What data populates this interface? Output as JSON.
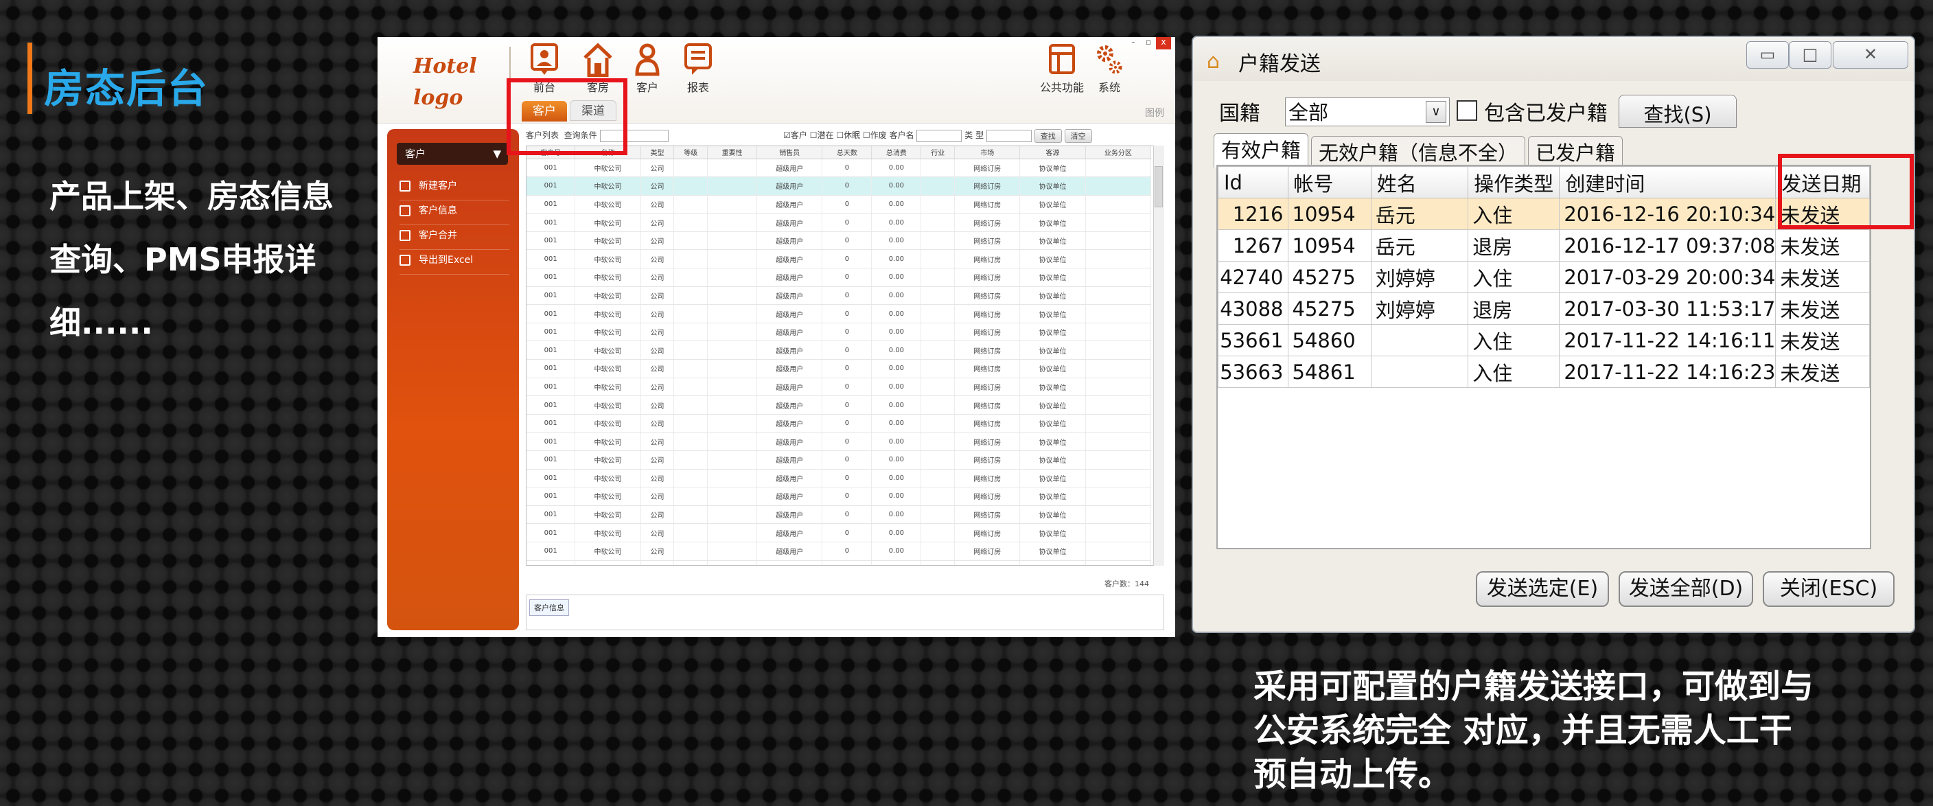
{
  "page": {
    "title": "房态后台",
    "left_desc": [
      "产品上架、房态信息",
      "查询、PMS申报详",
      "细......"
    ],
    "right_desc": [
      "采用可配置的户籍发送接口，可做到与",
      "公安系统完全 对应，并且无需人工干",
      "预自动上传。"
    ]
  },
  "hotel_app": {
    "logo_line1": "Hotel",
    "logo_line2": "logo",
    "nav": [
      {
        "label": "前台",
        "icon": "badge-icon"
      },
      {
        "label": "客房",
        "icon": "house-icon"
      },
      {
        "label": "客户",
        "icon": "person-icon"
      },
      {
        "label": "报表",
        "icon": "report-icon"
      }
    ],
    "nav_right": [
      {
        "label": "公共功能",
        "icon": "panel-icon"
      },
      {
        "label": "系统",
        "icon": "gears-icon"
      }
    ],
    "window_buttons": [
      "-",
      "▫",
      "x"
    ],
    "tabs": [
      "客户",
      "渠道"
    ],
    "legend": "图例",
    "sidebar": {
      "select": "客户",
      "items": [
        "新建客户",
        "客户信息",
        "客户合并",
        "导出到Excel"
      ]
    },
    "filter": {
      "list_label": "客户列表",
      "condition_label": "查询条件",
      "checks": [
        "客户",
        "潜在",
        "休眠",
        "作废"
      ],
      "name_label": "客户名",
      "type_label": "类 型",
      "search_btn": "查找",
      "clear_btn": "清空"
    },
    "columns": [
      "客户号",
      "名称",
      "类型",
      "等级",
      "重要性",
      "销售员",
      "总天数",
      "总消费",
      "行业",
      "市场",
      "客源",
      "业务分区"
    ],
    "row_template": [
      "001",
      "中软公司",
      "公司",
      "",
      "",
      "超级用户",
      "0",
      "0.00",
      "",
      "网络订房",
      "协议单位",
      ""
    ],
    "row_count": 23,
    "selected_row": 1,
    "footer_count": "客户数：144",
    "info_tab": "客户信息",
    "accent": "#e0520d"
  },
  "dialog": {
    "title": "户籍发送",
    "nationality_label": "国籍",
    "nationality_value": "全部",
    "include_sent_label": "包含已发户籍",
    "find_btn": "查找(S)",
    "tabs": [
      "有效户籍",
      "无效户籍（信息不全）",
      "已发户籍"
    ],
    "columns": [
      "Id",
      "帐号",
      "姓名",
      "操作类型",
      "创建时间",
      "发送日期"
    ],
    "rows": [
      [
        "1216",
        "10954",
        "岳元",
        "入住",
        "2016-12-16 20:10:34",
        "未发送"
      ],
      [
        "1267",
        "10954",
        "岳元",
        "退房",
        "2016-12-17 09:37:08",
        "未发送"
      ],
      [
        "42740",
        "45275",
        "刘婷婷",
        "入住",
        "2017-03-29 20:00:34",
        "未发送"
      ],
      [
        "43088",
        "45275",
        "刘婷婷",
        "退房",
        "2017-03-30 11:53:17",
        "未发送"
      ],
      [
        "53661",
        "54860",
        "",
        "入住",
        "2017-11-22 14:16:11",
        "未发送"
      ],
      [
        "53663",
        "54861",
        "",
        "入住",
        "2017-11-22 14:16:23",
        "未发送"
      ]
    ],
    "buttons": [
      "发送选定(E)",
      "发送全部(D)",
      "关闭(ESC)"
    ],
    "highlight_color": "#fdeac4"
  }
}
